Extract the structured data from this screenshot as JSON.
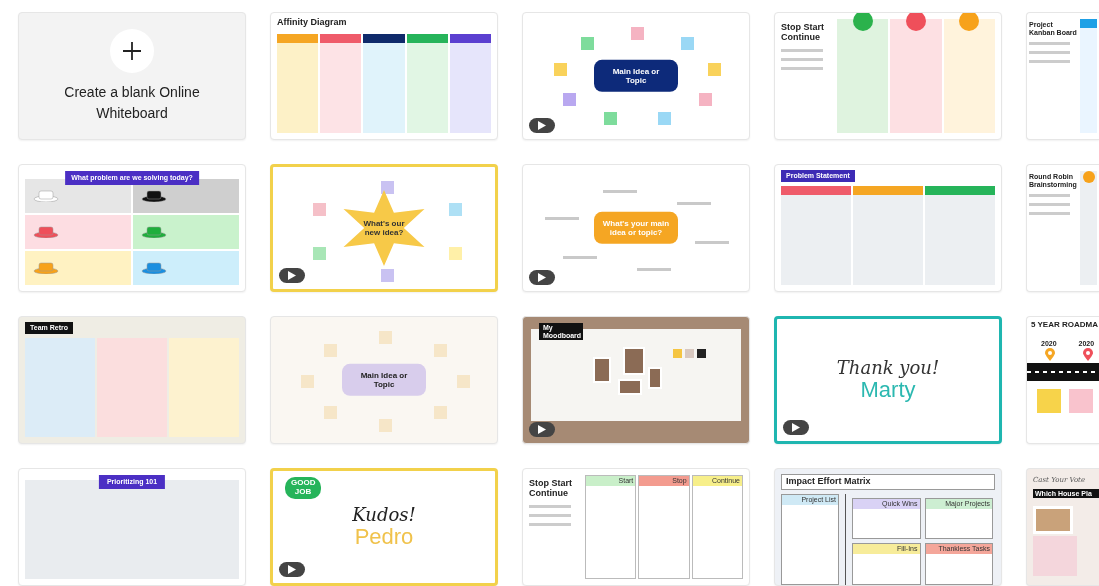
{
  "tiles": [
    {
      "kind": "blank",
      "text": "Create a blank Online Whiteboard"
    },
    {
      "kind": "columns",
      "title": "Affinity Diagram",
      "video": false,
      "columns": [
        {
          "color": "#fdf1c7",
          "header": {
            "color": "#f5a623"
          }
        },
        {
          "color": "#fde3e6",
          "header": {
            "color": "#ef5b6a"
          }
        },
        {
          "color": "#e0f3fb",
          "header": {
            "color": "#0f2a6b"
          }
        },
        {
          "color": "#e1f6e4",
          "header": {
            "color": "#26b45a"
          }
        },
        {
          "color": "#e6e5fb",
          "header": {
            "color": "#5b3fd0"
          }
        }
      ]
    },
    {
      "kind": "mindmap",
      "title": "Main Idea or Topic",
      "video": true,
      "bubble": {
        "color": "#0d2a7a"
      },
      "notes": [
        {
          "color": "#f5b3c2"
        },
        {
          "color": "#9ad8f5"
        },
        {
          "color": "#f9d25b"
        },
        {
          "color": "#f5b3c2"
        },
        {
          "color": "#9ad8f5"
        },
        {
          "color": "#7edc9c"
        },
        {
          "color": "#b9a8f0"
        },
        {
          "color": "#f9d25b"
        },
        {
          "color": "#7edc9c"
        }
      ]
    },
    {
      "kind": "sidebar",
      "title": "Stop Start Continue",
      "video": false,
      "columns": [
        {
          "color": "#dff3df",
          "dot": {
            "color": "#2bb24c"
          }
        },
        {
          "color": "#fde0e3",
          "dot": {
            "color": "#ef4f5a"
          }
        },
        {
          "color": "#fff3dc",
          "dot": {
            "color": "#f7a21b"
          }
        }
      ]
    },
    {
      "kind": "sidebar",
      "title": "Project Kanban Board",
      "video": false,
      "columns": [
        {
          "color": "#eaf5ff",
          "header": {
            "color": "#1ea0e6"
          }
        }
      ]
    },
    {
      "kind": "grid",
      "title": "What problem are we solving today?",
      "cells": [
        {
          "color": "#e6e6e6",
          "hat": {
            "color": "#ffffff"
          }
        },
        {
          "color": "#cfcfcf",
          "hat": {
            "color": "#111111"
          }
        },
        {
          "color": "#fddde2",
          "hat": {
            "color": "#ef4f5a"
          }
        },
        {
          "color": "#c9f2cc",
          "hat": {
            "color": "#1fae3c"
          }
        },
        {
          "color": "#fff2c2",
          "hat": {
            "color": "#f7a21b"
          }
        },
        {
          "color": "#cdeefb",
          "hat": {
            "color": "#1a8fe0"
          }
        }
      ]
    },
    {
      "kind": "star",
      "title": "What's our new idea?",
      "frame": {
        "color": "#f2d14b"
      },
      "video": true,
      "bubble": {
        "color": "#f7c948"
      },
      "notes": [
        {
          "color": "#c9c2f2"
        },
        {
          "color": "#aee0f5"
        },
        {
          "color": "#fff0a8"
        },
        {
          "color": "#c9c2f2"
        },
        {
          "color": "#a8e6b6"
        },
        {
          "color": "#f5c0c8"
        }
      ]
    },
    {
      "kind": "mindmap",
      "title": "What's your main idea or topic?",
      "video": true,
      "bubble": {
        "color": "#f5a623"
      }
    },
    {
      "kind": "columns",
      "title": "Problem Statement",
      "banner": {
        "color": "#3d2bb5"
      },
      "video": false,
      "columns": [
        {
          "color": "#eceff2",
          "header": {
            "color": "#ef5b6a"
          }
        },
        {
          "color": "#eceff2",
          "header": {
            "color": "#f5a623"
          }
        },
        {
          "color": "#eceff2",
          "header": {
            "color": "#26b45a"
          }
        }
      ]
    },
    {
      "kind": "sidebar",
      "title": "Round Robin Brainstorming",
      "video": false,
      "columns": [
        {
          "color": "#eceff2",
          "dot": {
            "color": "#f7a21b"
          }
        }
      ]
    },
    {
      "kind": "columns",
      "title": "Team Retro",
      "banner": {
        "color": "#111111"
      },
      "color": "#efede4",
      "video": false,
      "columns": [
        {
          "color": "#dcecf7"
        },
        {
          "color": "#fbdede"
        },
        {
          "color": "#fdf2cf"
        }
      ]
    },
    {
      "kind": "mindmap",
      "title": "Main Idea or Topic",
      "color": "#faf7f2",
      "video": false,
      "bubble": {
        "color": "#d8cdec"
      },
      "notes": [
        {
          "color": "#f6e6c8"
        },
        {
          "color": "#f6e6c8"
        },
        {
          "color": "#f6e6c8"
        },
        {
          "color": "#f6e6c8"
        },
        {
          "color": "#f6e6c8"
        },
        {
          "color": "#f6e6c8"
        },
        {
          "color": "#f6e6c8"
        },
        {
          "color": "#f6e6c8"
        }
      ]
    },
    {
      "kind": "moodboard",
      "title": "My Moodboard",
      "color": "#a68a74",
      "video": true
    },
    {
      "kind": "greeting",
      "frame": {
        "color": "#1fb6b0"
      },
      "video": true,
      "lines": [
        {
          "text": "Thank you!",
          "color": "#333333",
          "script": true
        },
        {
          "text": "Marty",
          "color": "#2bb8b0",
          "script": false
        }
      ]
    },
    {
      "kind": "roadmap",
      "title": "5 YEAR ROADMA",
      "years": [
        "2020",
        "2020"
      ]
    },
    {
      "kind": "banner",
      "title": "Prioritizing 101",
      "banner": {
        "color": "#4b2fc4"
      },
      "video": false,
      "columns": [
        {
          "color": "#e9ecef"
        }
      ]
    },
    {
      "kind": "greeting",
      "frame": {
        "color": "#f2d14b"
      },
      "video": true,
      "badge": "GOOD JOB",
      "lines": [
        {
          "text": "Kudos!",
          "color": "#222222",
          "script": true
        },
        {
          "text": "Pedro",
          "color": "#f0c24b",
          "script": false
        }
      ]
    },
    {
      "kind": "sidebar",
      "title": "Stop Start Continue",
      "video": false,
      "columns": [
        {
          "color": "#ffffff",
          "header": {
            "color": "#c9efc9",
            "label": "Start"
          }
        },
        {
          "color": "#ffffff",
          "header": {
            "color": "#f39b8f",
            "label": "Stop"
          }
        },
        {
          "color": "#ffffff",
          "header": {
            "color": "#f7ef8a",
            "label": "Continue"
          }
        }
      ]
    },
    {
      "kind": "matrix",
      "title": "Impact Effort Matrix",
      "side": "Project List",
      "quadrants": [
        {
          "label": "Quick Wins",
          "color": "#d9d2f5"
        },
        {
          "label": "Major Projects",
          "color": "#cdeed2"
        },
        {
          "label": "Fill-Ins",
          "color": "#f7ec9a"
        },
        {
          "label": "Thankless Tasks",
          "color": "#f4a69a"
        }
      ]
    },
    {
      "kind": "vote",
      "subtitle": "Cast Your Vote",
      "title": "Which House Pla",
      "color": "#f3ece8"
    }
  ]
}
